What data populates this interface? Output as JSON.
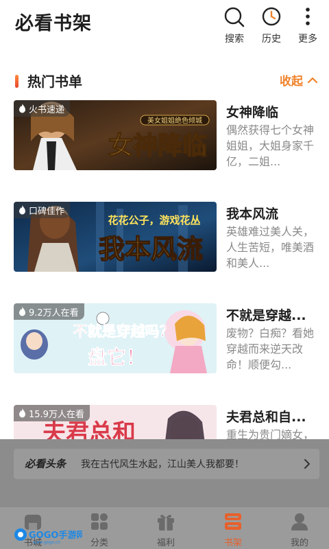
{
  "header": {
    "title": "必看书架",
    "actions": [
      {
        "label": "搜索",
        "icon": "search-icon"
      },
      {
        "label": "历史",
        "icon": "clock-icon"
      },
      {
        "label": "更多",
        "icon": "more-vertical-icon"
      }
    ]
  },
  "section": {
    "title": "热门书单",
    "collapse_label": "收起"
  },
  "books": [
    {
      "badge": "火书速递",
      "cover_text": "女神降临",
      "cover_tagline": "美女姐姐绝色倾城",
      "title": "女神降临",
      "desc": "偶然获得七个女神姐姐，大姐身家千亿，二姐..."
    },
    {
      "badge": "口碑佳作",
      "cover_text": "我本风流",
      "cover_tagline": "花花公子，游戏花丛",
      "title": "我本风流",
      "desc": "英雄难过美人关，人生苦短，唯美酒和美人..."
    },
    {
      "badge": "9.2万人在看",
      "cover_text": "盘它！",
      "cover_tagline": "不就是穿越吗？",
      "title": "不就是穿越...",
      "desc": "废物？白痴？看她穿越而来逆天改命！顺便勾..."
    },
    {
      "badge": "15.9万人在看",
      "cover_text": "夫君总和",
      "cover_tagline": "",
      "title": "夫君总和自...",
      "desc": "重生为贵门嫡女，这一世..."
    }
  ],
  "headline": {
    "brand": "必看头条",
    "text": "我在古代风生水起，江山美人我都要！"
  },
  "tabbar": {
    "tabs": [
      {
        "label": "书城",
        "icon": "home-icon",
        "active": false
      },
      {
        "label": "分类",
        "icon": "grid-icon",
        "active": false
      },
      {
        "label": "福利",
        "icon": "gift-icon",
        "active": false
      },
      {
        "label": "书架",
        "icon": "bookshelf-icon",
        "active": true
      },
      {
        "label": "我的",
        "icon": "user-icon",
        "active": false
      }
    ]
  },
  "watermark": {
    "brand": "GOGO手游网",
    "url": "www.gogo.cn"
  },
  "colors": {
    "accent": "#f0832c",
    "active_tab": "#e8602c",
    "title": "#1e1e1e",
    "desc": "#8a8a8a"
  }
}
